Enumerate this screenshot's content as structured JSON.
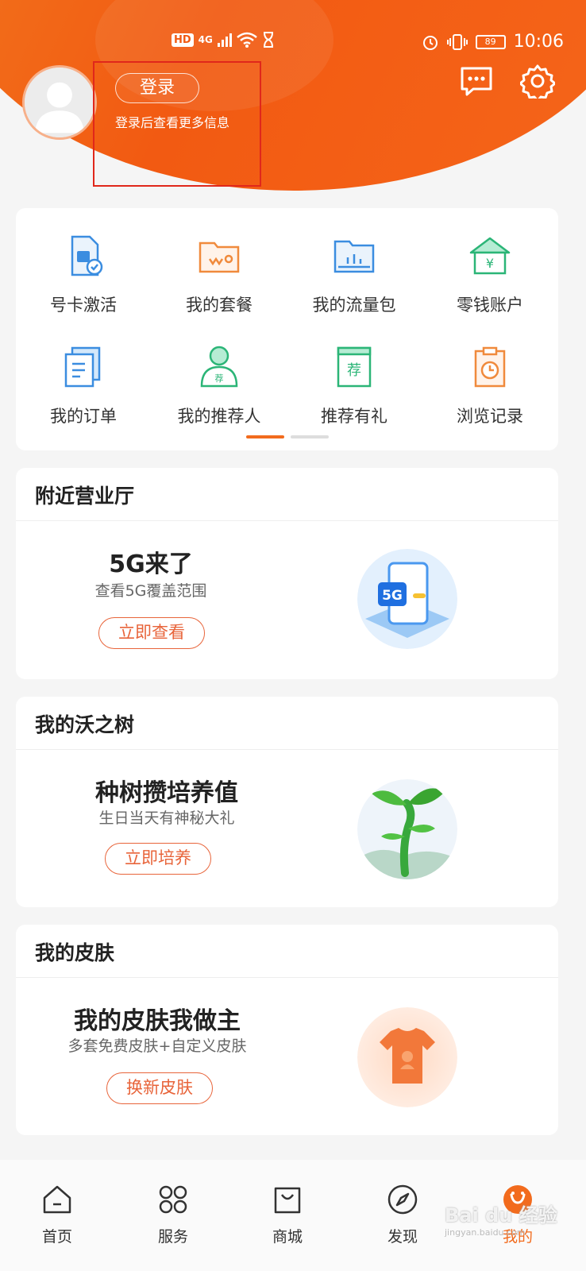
{
  "status_bar": {
    "network": "HD",
    "net_type": "4G",
    "battery": "89",
    "time": "10:06"
  },
  "profile": {
    "login_label": "登录",
    "login_hint": "登录后查看更多信息"
  },
  "colors": {
    "brand": "#f25a12",
    "accent": "#e8643a"
  },
  "quick_grid": [
    {
      "label": "号卡激活",
      "icon": "sim-card-icon"
    },
    {
      "label": "我的套餐",
      "icon": "package-icon"
    },
    {
      "label": "我的流量包",
      "icon": "data-package-icon"
    },
    {
      "label": "零钱账户",
      "icon": "wallet-house-icon"
    },
    {
      "label": "我的订单",
      "icon": "orders-icon"
    },
    {
      "label": "我的推荐人",
      "icon": "referrer-icon"
    },
    {
      "label": "推荐有礼",
      "icon": "referral-gift-icon"
    },
    {
      "label": "浏览记录",
      "icon": "history-icon"
    }
  ],
  "sections": {
    "nearby": {
      "title": "附近营业厅",
      "headline": "5G来了",
      "subtitle": "查看5G覆盖范围",
      "button": "立即查看",
      "image": "5g-phone-illustration"
    },
    "tree": {
      "title": "我的沃之树",
      "headline": "种树攒培养值",
      "subtitle": "生日当天有神秘大礼",
      "button": "立即培养",
      "image": "sprout-illustration"
    },
    "skin": {
      "title": "我的皮肤",
      "headline": "我的皮肤我做主",
      "subtitle": "多套免费皮肤+自定义皮肤",
      "button": "换新皮肤",
      "image": "tshirt-illustration"
    }
  },
  "bottom_nav": [
    {
      "label": "首页",
      "icon": "home-icon"
    },
    {
      "label": "服务",
      "icon": "services-icon"
    },
    {
      "label": "商城",
      "icon": "shop-bag-icon"
    },
    {
      "label": "发现",
      "icon": "compass-icon"
    },
    {
      "label": "我的",
      "icon": "profile-icon",
      "active": true
    }
  ],
  "watermark": {
    "text": "Bai du 经验",
    "sub": "jingyan.baidu.com"
  }
}
